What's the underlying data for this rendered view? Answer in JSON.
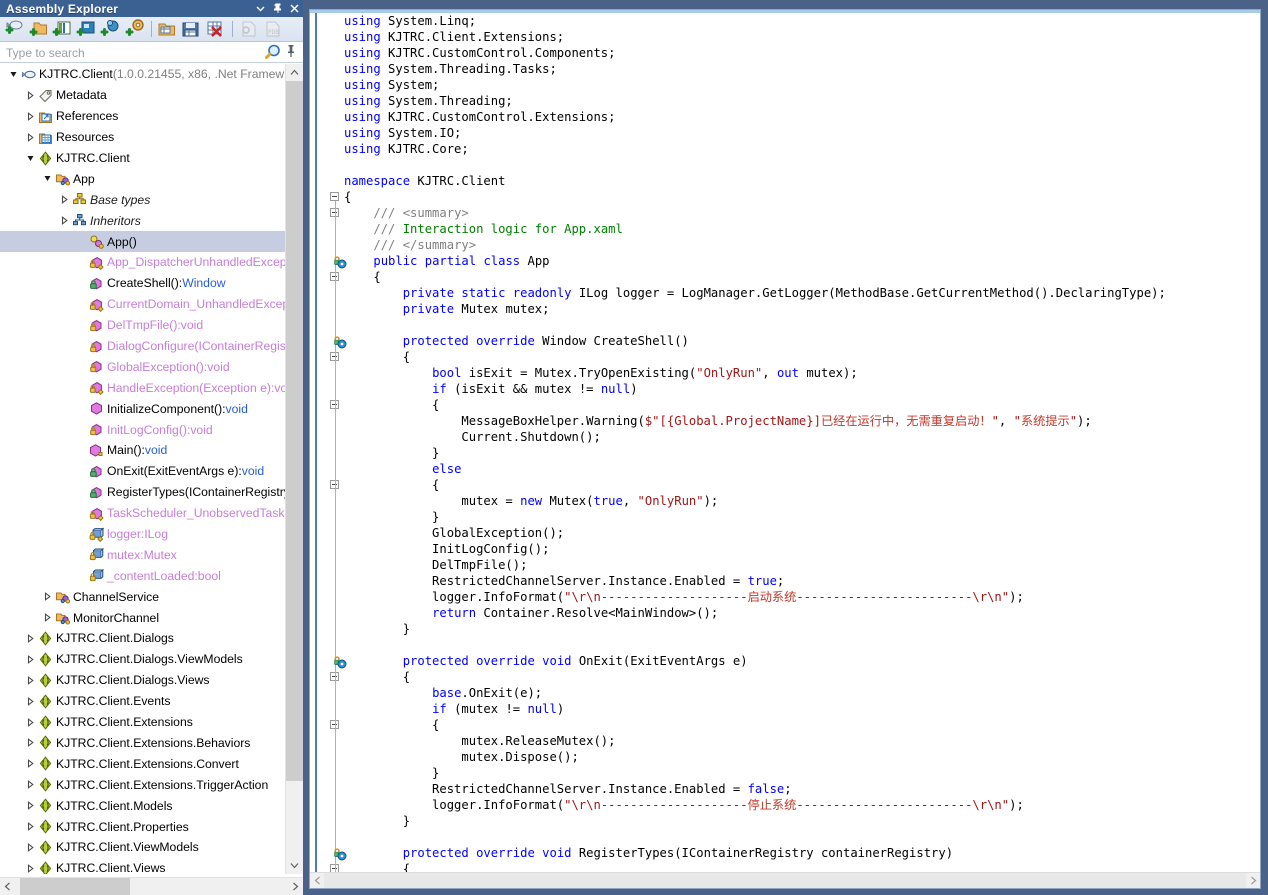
{
  "panel": {
    "title": "Assembly Explorer",
    "window_buttons": [
      "dropdown-caret",
      "auto-hide-pin",
      "close"
    ],
    "toolbar": {
      "buttons": [
        {
          "name": "open-assembly",
          "label": "Open Assembly"
        },
        {
          "name": "open-from-folder",
          "label": "Open from Folder"
        },
        {
          "name": "open-from-gac",
          "label": "Open from GAC"
        },
        {
          "name": "open-from-process",
          "label": "Open from Process"
        },
        {
          "name": "open-from-nuget",
          "label": "Open from NuGet"
        },
        {
          "name": "open-from-options",
          "label": "Options"
        },
        {
          "name": "open-assembly-list",
          "label": "Open Assembly List"
        },
        {
          "name": "save-assembly-list",
          "label": "Save Assembly List"
        },
        {
          "name": "close-all-assemblies",
          "label": "Close All Assemblies"
        },
        {
          "name": "load-symbols",
          "label": "Load Symbols"
        },
        {
          "name": "load-pdb",
          "label": "Load PDB"
        }
      ]
    },
    "search": {
      "placeholder": "Type to search",
      "value": "",
      "search_icon": "search-icon",
      "pin_icon": "pin-icon"
    }
  },
  "tree": {
    "items": [
      {
        "depth": 0,
        "expander": "expanded",
        "icon": "assembly-icon",
        "label": "KJTRC.Client ",
        "suffix": "(1.0.0.21455, x86, .Net Framew",
        "style": "plain",
        "selected": false
      },
      {
        "depth": 1,
        "expander": "collapsed",
        "icon": "metadata-icon",
        "label": "Metadata",
        "suffix": "",
        "style": "plain",
        "selected": false
      },
      {
        "depth": 1,
        "expander": "collapsed",
        "icon": "references-icon",
        "label": "References",
        "suffix": "",
        "style": "plain",
        "selected": false
      },
      {
        "depth": 1,
        "expander": "collapsed",
        "icon": "resources-icon",
        "label": "Resources",
        "suffix": "",
        "style": "plain",
        "selected": false
      },
      {
        "depth": 1,
        "expander": "expanded",
        "icon": "namespace-icon",
        "label": "KJTRC.Client",
        "suffix": "",
        "style": "plain",
        "selected": false
      },
      {
        "depth": 2,
        "expander": "expanded",
        "icon": "class-icon",
        "label": "App",
        "suffix": "",
        "style": "plain",
        "selected": false
      },
      {
        "depth": 3,
        "expander": "collapsed",
        "icon": "base-types-icon",
        "label": "Base types",
        "suffix": "",
        "style": "italic",
        "selected": false
      },
      {
        "depth": 3,
        "expander": "collapsed",
        "icon": "inheritors-icon",
        "label": "Inheritors",
        "suffix": "",
        "style": "italic",
        "selected": false
      },
      {
        "depth": 4,
        "expander": "none",
        "icon": "ctor-icon",
        "label": "App()",
        "suffix": "",
        "style": "plain",
        "selected": true
      },
      {
        "depth": 4,
        "expander": "none",
        "icon": "private-event-method-icon",
        "label": "App_DispatcherUnhandledExceptio",
        "suffix": "",
        "style": "purple",
        "selected": false
      },
      {
        "depth": 4,
        "expander": "none",
        "icon": "protected-method-icon",
        "label": "CreateShell():",
        "suffix": "Window",
        "style": "method-ret",
        "selected": false
      },
      {
        "depth": 4,
        "expander": "none",
        "icon": "private-event-method-icon",
        "label": "CurrentDomain_UnhandledExceptio",
        "suffix": "",
        "style": "purple",
        "selected": false
      },
      {
        "depth": 4,
        "expander": "none",
        "icon": "private-method-icon",
        "label": "DelTmpFile():void",
        "suffix": "",
        "style": "purple",
        "selected": false
      },
      {
        "depth": 4,
        "expander": "none",
        "icon": "private-method-icon",
        "label": "DialogConfigure(IContainerRegistry",
        "suffix": "",
        "style": "purple",
        "selected": false
      },
      {
        "depth": 4,
        "expander": "none",
        "icon": "private-method-icon",
        "label": "GlobalException():void",
        "suffix": "",
        "style": "purple",
        "selected": false
      },
      {
        "depth": 4,
        "expander": "none",
        "icon": "private-event-method-icon",
        "label": "HandleException(Exception e):void",
        "suffix": "",
        "style": "purple",
        "selected": false
      },
      {
        "depth": 4,
        "expander": "none",
        "icon": "public-method-icon",
        "label": "InitializeComponent():",
        "suffix": "void",
        "style": "method-ret",
        "selected": false
      },
      {
        "depth": 4,
        "expander": "none",
        "icon": "private-method-icon",
        "label": "InitLogConfig():void",
        "suffix": "",
        "style": "purple",
        "selected": false
      },
      {
        "depth": 4,
        "expander": "none",
        "icon": "public-static-method-icon",
        "label": "Main():",
        "suffix": "void",
        "style": "method-ret",
        "selected": false
      },
      {
        "depth": 4,
        "expander": "none",
        "icon": "protected-method-icon",
        "label": "OnExit(ExitEventArgs e):",
        "suffix": "void",
        "style": "method-ret",
        "selected": false
      },
      {
        "depth": 4,
        "expander": "none",
        "icon": "protected-method-icon",
        "label": "RegisterTypes(IContainerRegistry c",
        "suffix": "",
        "style": "plain",
        "selected": false
      },
      {
        "depth": 4,
        "expander": "none",
        "icon": "private-event-method-icon",
        "label": "TaskScheduler_UnobservedTaskEx",
        "suffix": "",
        "style": "purple",
        "selected": false
      },
      {
        "depth": 4,
        "expander": "none",
        "icon": "private-static-field-icon",
        "label": "logger:ILog",
        "suffix": "",
        "style": "purple",
        "selected": false
      },
      {
        "depth": 4,
        "expander": "none",
        "icon": "private-field-icon",
        "label": "mutex:Mutex",
        "suffix": "",
        "style": "purple",
        "selected": false
      },
      {
        "depth": 4,
        "expander": "none",
        "icon": "private-field-icon",
        "label": "_contentLoaded:bool",
        "suffix": "",
        "style": "purple",
        "selected": false
      },
      {
        "depth": 2,
        "expander": "collapsed",
        "icon": "class-icon",
        "label": "ChannelService",
        "suffix": "",
        "style": "plain",
        "selected": false
      },
      {
        "depth": 2,
        "expander": "collapsed",
        "icon": "class-icon",
        "label": "MonitorChannel",
        "suffix": "",
        "style": "plain",
        "selected": false
      },
      {
        "depth": 1,
        "expander": "collapsed",
        "icon": "namespace-icon",
        "label": "KJTRC.Client.Dialogs",
        "suffix": "",
        "style": "plain",
        "selected": false
      },
      {
        "depth": 1,
        "expander": "collapsed",
        "icon": "namespace-icon",
        "label": "KJTRC.Client.Dialogs.ViewModels",
        "suffix": "",
        "style": "plain",
        "selected": false
      },
      {
        "depth": 1,
        "expander": "collapsed",
        "icon": "namespace-icon",
        "label": "KJTRC.Client.Dialogs.Views",
        "suffix": "",
        "style": "plain",
        "selected": false
      },
      {
        "depth": 1,
        "expander": "collapsed",
        "icon": "namespace-icon",
        "label": "KJTRC.Client.Events",
        "suffix": "",
        "style": "plain",
        "selected": false
      },
      {
        "depth": 1,
        "expander": "collapsed",
        "icon": "namespace-icon",
        "label": "KJTRC.Client.Extensions",
        "suffix": "",
        "style": "plain",
        "selected": false
      },
      {
        "depth": 1,
        "expander": "collapsed",
        "icon": "namespace-icon",
        "label": "KJTRC.Client.Extensions.Behaviors",
        "suffix": "",
        "style": "plain",
        "selected": false
      },
      {
        "depth": 1,
        "expander": "collapsed",
        "icon": "namespace-icon",
        "label": "KJTRC.Client.Extensions.Convert",
        "suffix": "",
        "style": "plain",
        "selected": false
      },
      {
        "depth": 1,
        "expander": "collapsed",
        "icon": "namespace-icon",
        "label": "KJTRC.Client.Extensions.TriggerAction",
        "suffix": "",
        "style": "plain",
        "selected": false
      },
      {
        "depth": 1,
        "expander": "collapsed",
        "icon": "namespace-icon",
        "label": "KJTRC.Client.Models",
        "suffix": "",
        "style": "plain",
        "selected": false
      },
      {
        "depth": 1,
        "expander": "collapsed",
        "icon": "namespace-icon",
        "label": "KJTRC.Client.Properties",
        "suffix": "",
        "style": "plain",
        "selected": false
      },
      {
        "depth": 1,
        "expander": "collapsed",
        "icon": "namespace-icon",
        "label": "KJTRC.Client.ViewModels",
        "suffix": "",
        "style": "plain",
        "selected": false
      },
      {
        "depth": 1,
        "expander": "collapsed",
        "icon": "namespace-icon",
        "label": "KJTRC.Client.Views",
        "suffix": "",
        "style": "plain",
        "selected": false
      }
    ]
  },
  "editor": {
    "language": "csharp",
    "colors": {
      "keyword": "#0000ff",
      "type": "#2b91af",
      "comment": "#008000",
      "comment_tag": "#808080",
      "string": "#a31515",
      "chinese_text": "#c0392b",
      "background": "#ffffff"
    },
    "code_lines": [
      "using System.Linq;",
      "using KJTRC.Client.Extensions;",
      "using KJTRC.CustomControl.Components;",
      "using System.Threading.Tasks;",
      "using System;",
      "using System.Threading;",
      "using KJTRC.CustomControl.Extensions;",
      "using System.IO;",
      "using KJTRC.Core;",
      "",
      "namespace KJTRC.Client",
      "{",
      "    /// <summary>",
      "    /// Interaction logic for App.xaml",
      "    /// </summary>",
      "    public partial class App",
      "    {",
      "        private static readonly ILog logger = LogManager.GetLogger(MethodBase.GetCurrentMethod().DeclaringType);",
      "        private Mutex mutex;",
      "",
      "        protected override Window CreateShell()",
      "        {",
      "            bool isExit = Mutex.TryOpenExisting(\"OnlyRun\", out mutex);",
      "            if (isExit && mutex != null)",
      "            {",
      "                MessageBoxHelper.Warning($\"[{Global.ProjectName}]已经在运行中，无需重复启动！\", \"系统提示\");",
      "                Current.Shutdown();",
      "            }",
      "            else",
      "            {",
      "                mutex = new Mutex(true, \"OnlyRun\");",
      "            }",
      "            GlobalException();",
      "            InitLogConfig();",
      "            DelTmpFile();",
      "            RestrictedChannelServer.Instance.Enabled = true;",
      "            logger.InfoFormat(\"\\r\\n--------------------启动系统------------------------\\r\\n\");",
      "            return Container.Resolve<MainWindow>();",
      "        }",
      "",
      "        protected override void OnExit(ExitEventArgs e)",
      "        {",
      "            base.OnExit(e);",
      "            if (mutex != null)",
      "            {",
      "                mutex.ReleaseMutex();",
      "                mutex.Dispose();",
      "            }",
      "            RestrictedChannelServer.Instance.Enabled = false;",
      "            logger.InfoFormat(\"\\r\\n--------------------停止系统------------------------\\r\\n\");",
      "        }",
      "",
      "        protected override void RegisterTypes(IContainerRegistry containerRegistry)",
      "        {"
    ]
  }
}
